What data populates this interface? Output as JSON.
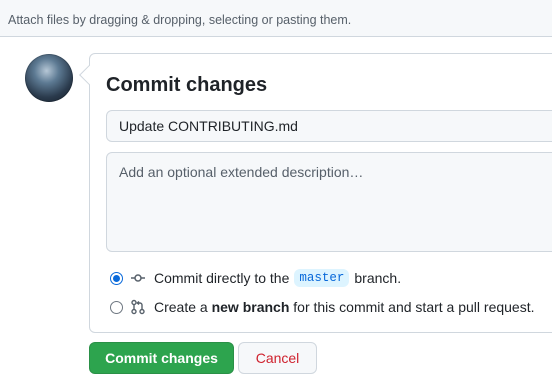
{
  "drop_hint": "Attach files by dragging & dropping, selecting or pasting them.",
  "commit": {
    "title": "Commit changes",
    "summary_value": "Update CONTRIBUTING.md",
    "description_placeholder": "Add an optional extended description…"
  },
  "options": {
    "direct": {
      "prefix": "Commit directly to the",
      "branch": "master",
      "suffix": "branch.",
      "icon": "git-commit-icon",
      "selected": true
    },
    "new_branch": {
      "prefix": "Create a",
      "bold": "new branch",
      "suffix": "for this commit and start a pull request.",
      "icon": "git-pull-request-icon",
      "selected": false
    }
  },
  "buttons": {
    "commit_label": "Commit changes",
    "cancel_label": "Cancel"
  },
  "colors": {
    "primary": "#2da44e",
    "accent": "#0969da",
    "danger": "#cf222e"
  }
}
